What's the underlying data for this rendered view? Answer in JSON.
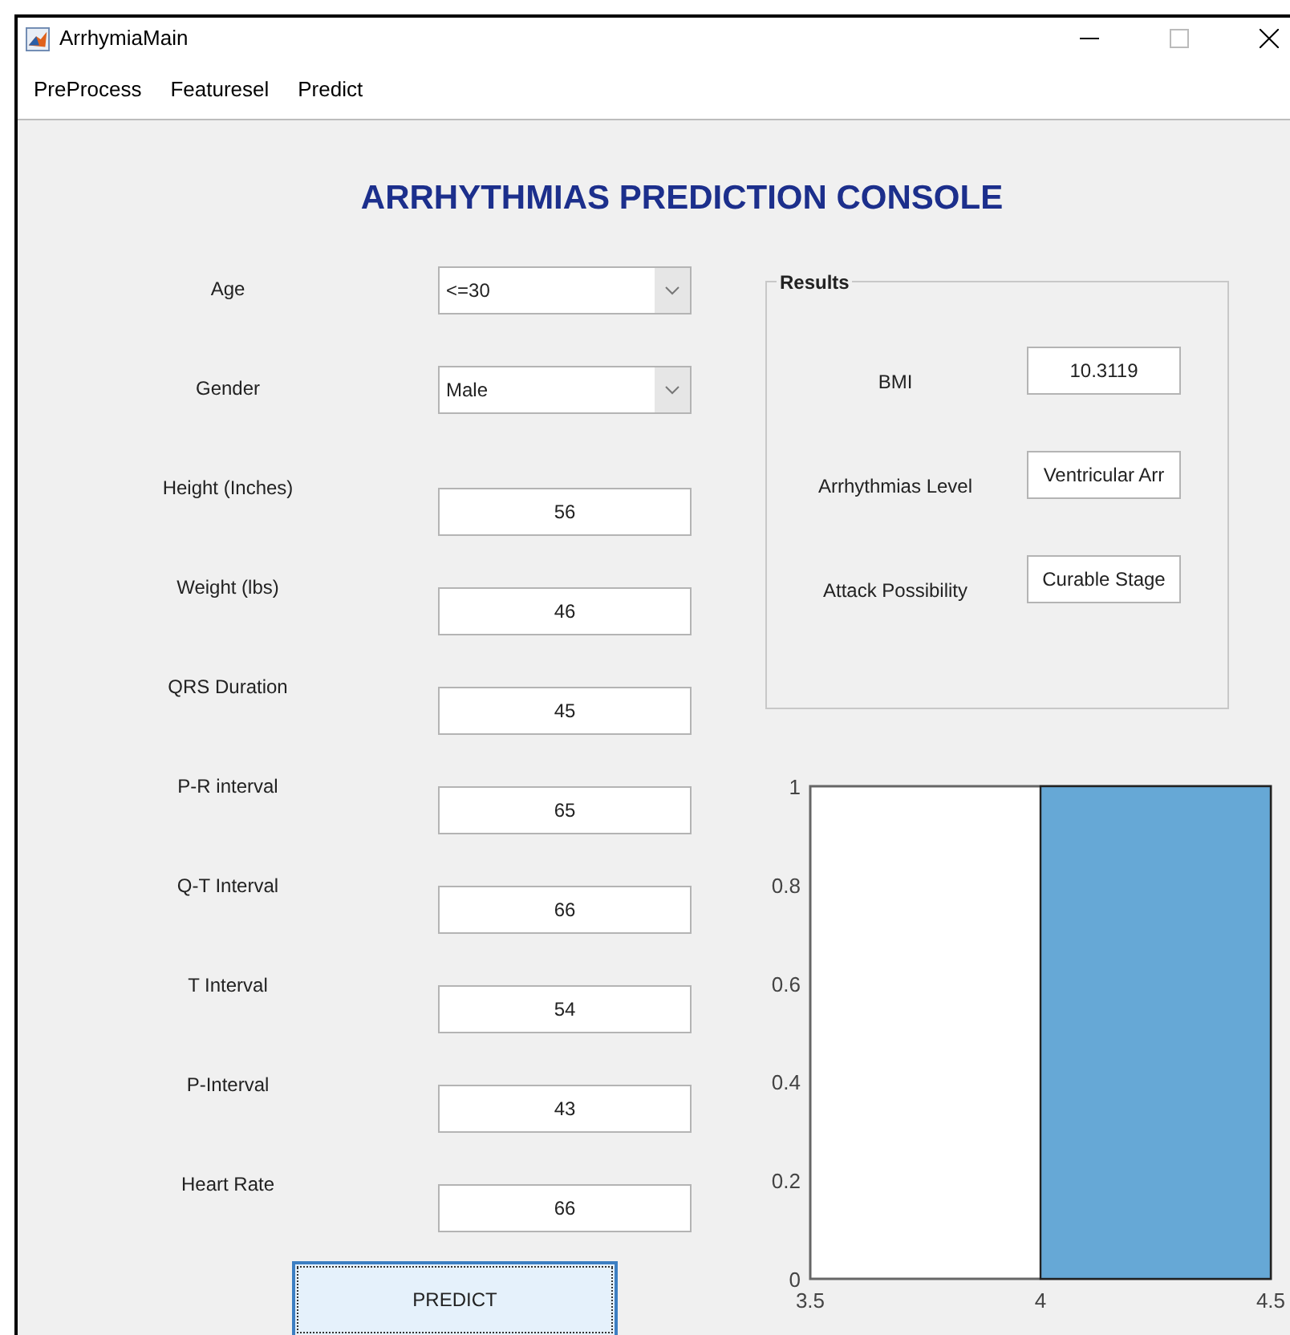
{
  "window": {
    "title": "ArrhymiaMain"
  },
  "menu": [
    "PreProcess",
    "Featuresel",
    "Predict"
  ],
  "heading": "ARRHYTHMIAS PREDICTION CONSOLE",
  "inputs": [
    {
      "label": "Age",
      "value": "<=30",
      "kind": "dropdown"
    },
    {
      "label": "Gender",
      "value": "Male",
      "kind": "dropdown"
    },
    {
      "label": "Height (Inches)",
      "value": "56",
      "kind": "text"
    },
    {
      "label": "Weight (lbs)",
      "value": "46",
      "kind": "text"
    },
    {
      "label": "QRS Duration",
      "value": "45",
      "kind": "text"
    },
    {
      "label": "P-R interval",
      "value": "65",
      "kind": "text"
    },
    {
      "label": "Q-T Interval",
      "value": "66",
      "kind": "text"
    },
    {
      "label": "T Interval",
      "value": "54",
      "kind": "text"
    },
    {
      "label": "P-Interval",
      "value": "43",
      "kind": "text"
    },
    {
      "label": "Heart Rate",
      "value": "66",
      "kind": "text"
    }
  ],
  "predict_button": "PREDICT",
  "results": {
    "title": "Results",
    "items": [
      {
        "label": "BMI",
        "value": "10.3119"
      },
      {
        "label": "Arrhythmias Level",
        "value": "Ventricular Arr"
      },
      {
        "label": "Attack Possibility",
        "value": "Curable Stage"
      }
    ]
  },
  "chart_data": {
    "type": "bar",
    "x": [
      4.25
    ],
    "series": [
      {
        "color": "#66a8d6",
        "values": [
          1
        ]
      }
    ],
    "xlim": [
      3.5,
      4.5
    ],
    "ylim": [
      0,
      1
    ],
    "xticks": [
      3.5,
      4,
      4.5
    ],
    "yticks": [
      0,
      0.2,
      0.4,
      0.6,
      0.8,
      1
    ]
  }
}
